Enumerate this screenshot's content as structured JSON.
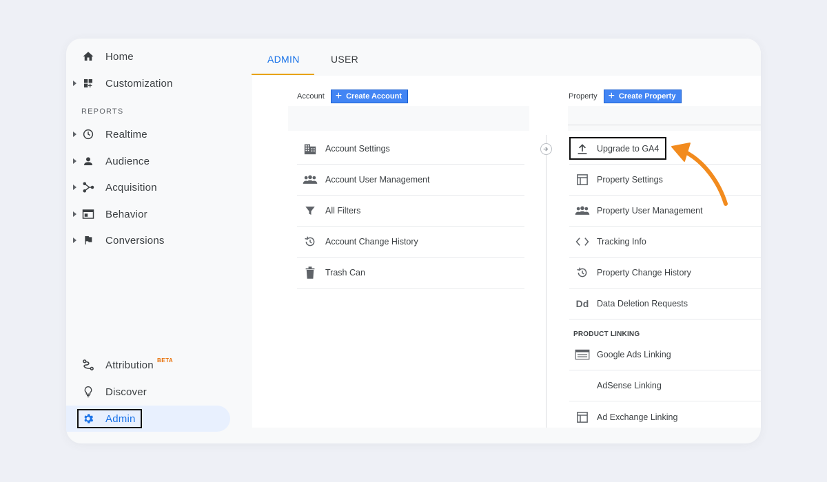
{
  "sidebar": {
    "home": "Home",
    "customization": "Customization",
    "reports_label": "REPORTS",
    "realtime": "Realtime",
    "audience": "Audience",
    "acquisition": "Acquisition",
    "behavior": "Behavior",
    "conversions": "Conversions",
    "attribution": "Attribution",
    "attribution_badge": "BETA",
    "discover": "Discover",
    "admin": "Admin"
  },
  "tabs": {
    "admin": "ADMIN",
    "user": "USER",
    "active": "ADMIN"
  },
  "account": {
    "caption": "Account",
    "create_label": "Create Account",
    "items": [
      {
        "label": "Account Settings",
        "icon": "building-icon"
      },
      {
        "label": "Account User Management",
        "icon": "people-icon"
      },
      {
        "label": "All Filters",
        "icon": "filter-icon"
      },
      {
        "label": "Account Change History",
        "icon": "history-icon"
      },
      {
        "label": "Trash Can",
        "icon": "trash-icon"
      }
    ]
  },
  "property": {
    "caption": "Property",
    "create_label": "Create Property",
    "items": [
      {
        "label": "Upgrade to GA4",
        "icon": "upload-icon"
      },
      {
        "label": "Property Settings",
        "icon": "layout-icon"
      },
      {
        "label": "Property User Management",
        "icon": "people-icon"
      },
      {
        "label": "Tracking Info",
        "icon": "code-icon"
      },
      {
        "label": "Property Change History",
        "icon": "history-icon"
      },
      {
        "label": "Data Deletion Requests",
        "icon": "dd-icon"
      }
    ],
    "linking_section": "PRODUCT LINKING",
    "linking_items": [
      {
        "label": "Google Ads Linking",
        "icon": "ads-icon"
      },
      {
        "label": "AdSense Linking",
        "icon": ""
      },
      {
        "label": "Ad Exchange Linking",
        "icon": "layout-icon"
      }
    ],
    "dd_glyph": "Dd"
  },
  "colors": {
    "accent": "#1a73e8",
    "button": "#4285f4",
    "tab_underline": "#e8a202",
    "arrow": "#f28b1e",
    "beta": "#e8710a"
  }
}
